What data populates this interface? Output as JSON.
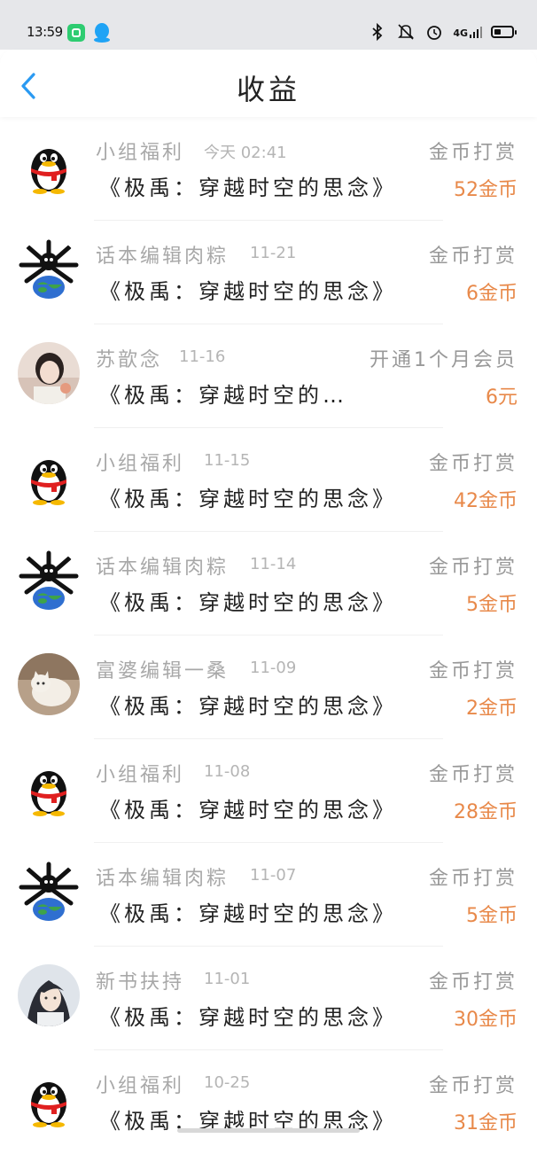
{
  "status_bar": {
    "time": "13:59",
    "network": "4G"
  },
  "header": {
    "title": "收益"
  },
  "records": [
    {
      "name": "小组福利",
      "date": "今天 02:41",
      "type": "金币打赏",
      "book": "《极禹：穿越时空的思念》",
      "amount": "52金币",
      "avatar": "qq-penguin-icon"
    },
    {
      "name": "话本编辑肉粽",
      "date": "11-21",
      "type": "金币打赏",
      "book": "《极禹：穿越时空的思念》",
      "amount": "6金币",
      "avatar": "globe-creature-avatar"
    },
    {
      "name": "苏歆念",
      "date": "11-16",
      "type": "开通1个月会员",
      "book": "《极禹：穿越时空的…",
      "amount": "6元",
      "avatar": "girl-photo-avatar"
    },
    {
      "name": "小组福利",
      "date": "11-15",
      "type": "金币打赏",
      "book": "《极禹：穿越时空的思念》",
      "amount": "42金币",
      "avatar": "qq-penguin-icon"
    },
    {
      "name": "话本编辑肉粽",
      "date": "11-14",
      "type": "金币打赏",
      "book": "《极禹：穿越时空的思念》",
      "amount": "5金币",
      "avatar": "globe-creature-avatar"
    },
    {
      "name": "富婆编辑一桑",
      "date": "11-09",
      "type": "金币打赏",
      "book": "《极禹：穿越时空的思念》",
      "amount": "2金币",
      "avatar": "cat-photo-avatar"
    },
    {
      "name": "小组福利",
      "date": "11-08",
      "type": "金币打赏",
      "book": "《极禹：穿越时空的思念》",
      "amount": "28金币",
      "avatar": "qq-penguin-icon"
    },
    {
      "name": "话本编辑肉粽",
      "date": "11-07",
      "type": "金币打赏",
      "book": "《极禹：穿越时空的思念》",
      "amount": "5金币",
      "avatar": "globe-creature-avatar"
    },
    {
      "name": "新书扶持",
      "date": "11-01",
      "type": "金币打赏",
      "book": "《极禹：穿越时空的思念》",
      "amount": "30金币",
      "avatar": "anime-man-avatar"
    },
    {
      "name": "小组福利",
      "date": "10-25",
      "type": "金币打赏",
      "book": "《极禹：穿越时空的思念》",
      "amount": "31金币",
      "avatar": "qq-penguin-icon"
    }
  ],
  "colors": {
    "amount": "#e8894a",
    "back_arrow": "#2a9af2"
  }
}
